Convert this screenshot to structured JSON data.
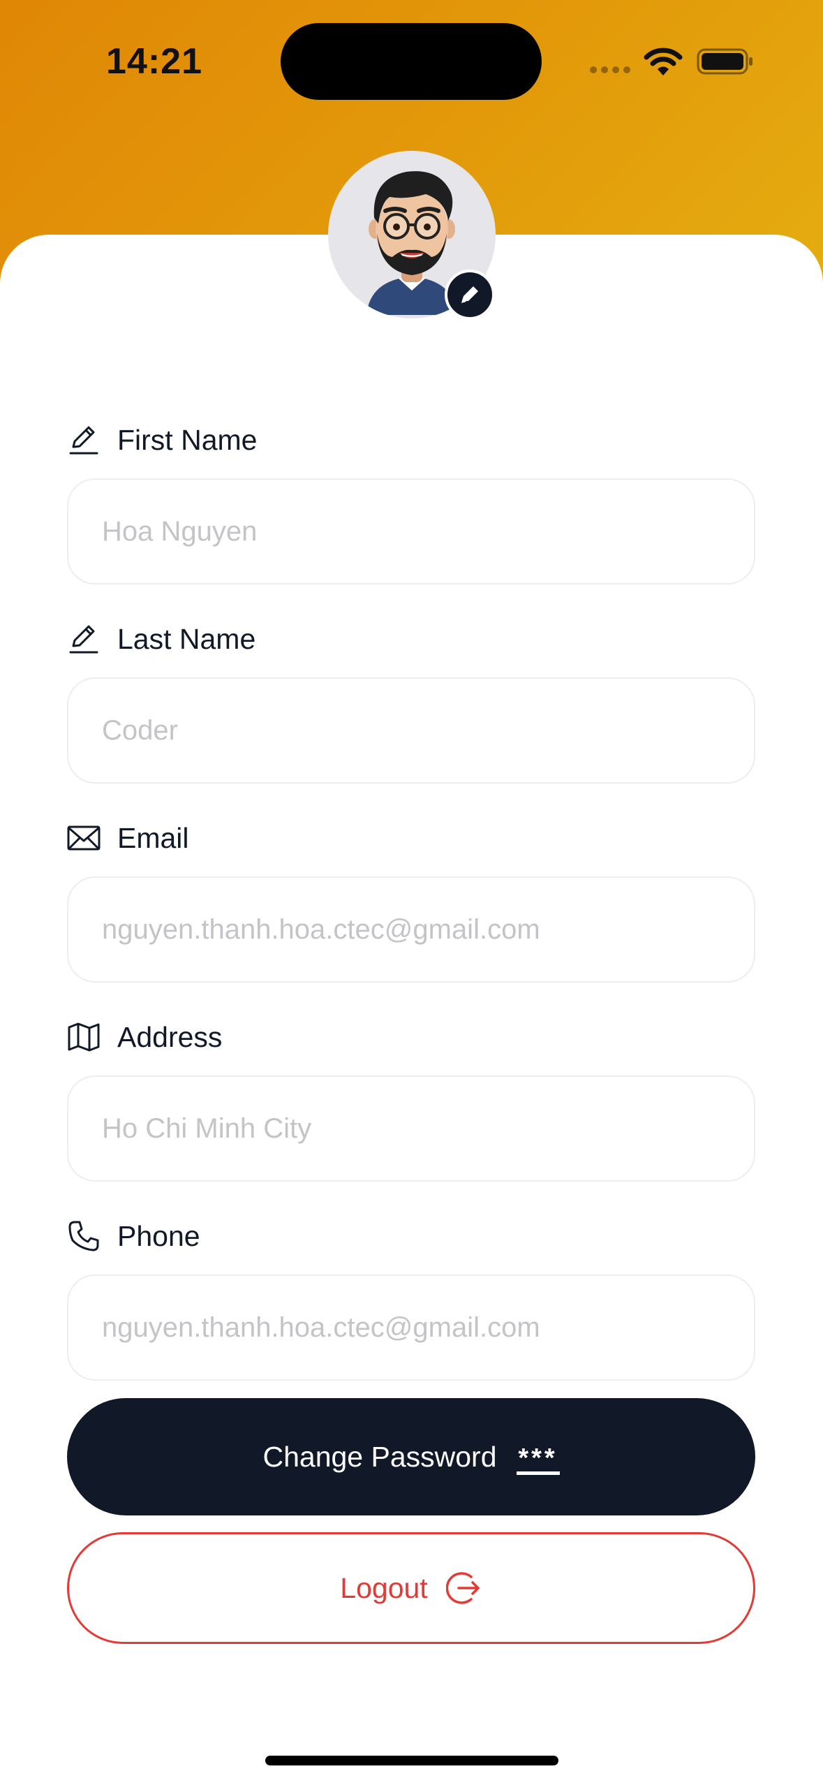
{
  "status_bar": {
    "time": "14:21"
  },
  "profile": {
    "avatar_icon": "memoji-avatar",
    "edit_icon": "pencil-icon"
  },
  "fields": [
    {
      "label": "First Name",
      "icon": "pencil-line-icon",
      "value": "",
      "placeholder": "Hoa Nguyen"
    },
    {
      "label": "Last Name",
      "icon": "pencil-line-icon",
      "value": "",
      "placeholder": "Coder"
    },
    {
      "label": "Email",
      "icon": "envelope-icon",
      "value": "",
      "placeholder": "nguyen.thanh.hoa.ctec@gmail.com"
    },
    {
      "label": "Address",
      "icon": "map-icon",
      "value": "",
      "placeholder": "Ho Chi Minh City"
    },
    {
      "label": "Phone",
      "icon": "phone-icon",
      "value": "",
      "placeholder": "nguyen.thanh.hoa.ctec@gmail.com"
    }
  ],
  "actions": {
    "change_password_label": "Change Password",
    "change_password_glyph": "***",
    "logout_label": "Logout"
  },
  "colors": {
    "header_gradient_start": "#e08706",
    "header_gradient_end": "#e4ad10",
    "primary_dark": "#111827",
    "danger": "#e53935",
    "placeholder": "#c4c4c8",
    "field_border": "#ededf0"
  }
}
